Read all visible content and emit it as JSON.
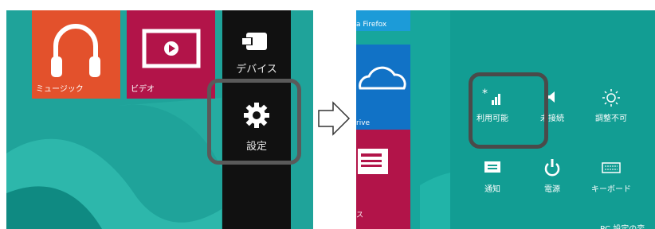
{
  "left_panel": {
    "tiles": [
      {
        "label": "ミュージック",
        "icon": "headphones-icon",
        "color": "#e3512c"
      },
      {
        "label": "ビデオ",
        "icon": "play-icon",
        "color": "#b21449"
      }
    ],
    "charms": [
      {
        "label": "デバイス",
        "icon": "devices-icon"
      },
      {
        "label": "設定",
        "icon": "gear-icon",
        "highlighted": true
      }
    ]
  },
  "arrow": {
    "icon": "right-arrow-icon"
  },
  "right_panel": {
    "tiles": [
      {
        "label": "a Firefox"
      },
      {
        "label": "rive",
        "icon": "cloud-icon"
      },
      {
        "label": "ス",
        "icon": "news-icon"
      }
    ],
    "quick_settings": [
      {
        "label": "利用可能",
        "icon": "wifi-signal-icon",
        "highlighted": true
      },
      {
        "label": "未接続",
        "icon": "volume-icon"
      },
      {
        "label": "調整不可",
        "icon": "brightness-icon"
      },
      {
        "label": "通知",
        "icon": "notifications-icon"
      },
      {
        "label": "電源",
        "icon": "power-icon"
      },
      {
        "label": "キーボード",
        "icon": "keyboard-icon"
      }
    ],
    "footer_text": "PC 設定の変"
  }
}
